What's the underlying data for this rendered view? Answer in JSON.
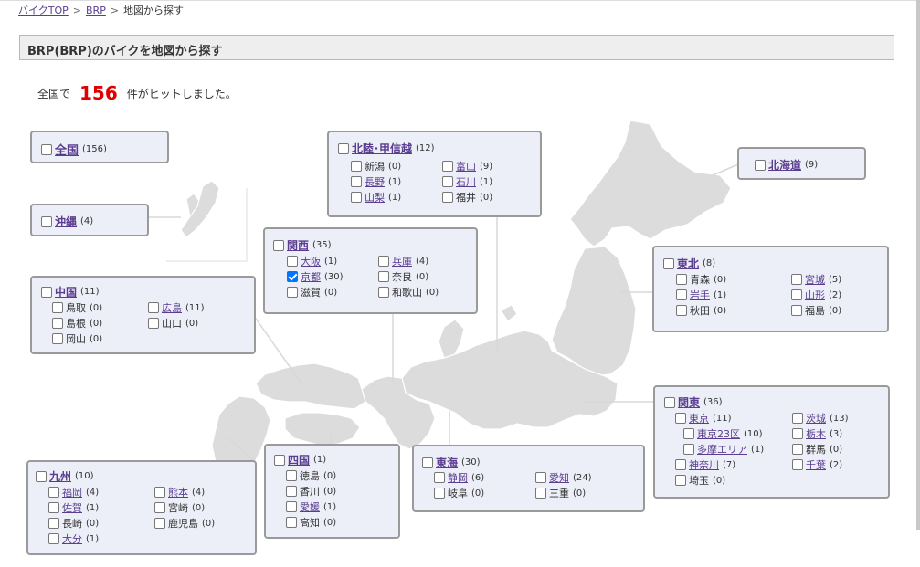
{
  "breadcrumb": {
    "home": "バイクTOP",
    "brand": "BRP",
    "current": "地図から探す",
    "sep": ">"
  },
  "page_title": "BRP(BRP)のバイクを地図から探す",
  "result": {
    "prefix": "全国で",
    "count": "156",
    "suffix": "件がヒットしました。"
  },
  "regions": {
    "all": {
      "name": "全国",
      "count": "(156)"
    },
    "okinawa": {
      "name": "沖縄",
      "count": "(4)"
    },
    "hokuriku": {
      "name": "北陸･甲信越",
      "count": "(12)",
      "items": [
        {
          "name": "新潟",
          "count": "(0)",
          "link": false
        },
        {
          "name": "富山",
          "count": "(9)",
          "link": true
        },
        {
          "name": "長野",
          "count": "(1)",
          "link": true
        },
        {
          "name": "石川",
          "count": "(1)",
          "link": true
        },
        {
          "name": "山梨",
          "count": "(1)",
          "link": true
        },
        {
          "name": "福井",
          "count": "(0)",
          "link": false
        }
      ]
    },
    "hokkaido": {
      "name": "北海道",
      "count": "(9)"
    },
    "kansai": {
      "name": "関西",
      "count": "(35)",
      "items": [
        {
          "name": "大阪",
          "count": "(1)",
          "link": true
        },
        {
          "name": "兵庫",
          "count": "(4)",
          "link": true
        },
        {
          "name": "京都",
          "count": "(30)",
          "link": true,
          "checked": true
        },
        {
          "name": "奈良",
          "count": "(0)",
          "link": false
        },
        {
          "name": "滋賀",
          "count": "(0)",
          "link": false
        },
        {
          "name": "和歌山",
          "count": "(0)",
          "link": false
        }
      ]
    },
    "chugoku": {
      "name": "中国",
      "count": "(11)",
      "items": [
        {
          "name": "鳥取",
          "count": "(0)",
          "link": false
        },
        {
          "name": "広島",
          "count": "(11)",
          "link": true
        },
        {
          "name": "島根",
          "count": "(0)",
          "link": false
        },
        {
          "name": "山口",
          "count": "(0)",
          "link": false
        },
        {
          "name": "岡山",
          "count": "(0)",
          "link": false
        }
      ]
    },
    "tohoku": {
      "name": "東北",
      "count": "(8)",
      "items": [
        {
          "name": "青森",
          "count": "(0)",
          "link": false
        },
        {
          "name": "宮城",
          "count": "(5)",
          "link": true
        },
        {
          "name": "岩手",
          "count": "(1)",
          "link": true
        },
        {
          "name": "山形",
          "count": "(2)",
          "link": true
        },
        {
          "name": "秋田",
          "count": "(0)",
          "link": false
        },
        {
          "name": "福島",
          "count": "(0)",
          "link": false
        }
      ]
    },
    "kanto": {
      "name": "関東",
      "count": "(36)",
      "items": [
        {
          "name": "東京",
          "count": "(11)",
          "link": true
        },
        {
          "name": "茨城",
          "count": "(13)",
          "link": true
        },
        {
          "name": "東京23区",
          "count": "(10)",
          "link": true
        },
        {
          "name": "栃木",
          "count": "(3)",
          "link": true
        },
        {
          "name": "多摩エリア",
          "count": "(1)",
          "link": true
        },
        {
          "name": "群馬",
          "count": "(0)",
          "link": false
        },
        {
          "name": "神奈川",
          "count": "(7)",
          "link": true
        },
        {
          "name": "千葉",
          "count": "(2)",
          "link": true
        },
        {
          "name": "埼玉",
          "count": "(0)",
          "link": false
        }
      ]
    },
    "kyushu": {
      "name": "九州",
      "count": "(10)",
      "items": [
        {
          "name": "福岡",
          "count": "(4)",
          "link": true
        },
        {
          "name": "熊本",
          "count": "(4)",
          "link": true
        },
        {
          "name": "佐賀",
          "count": "(1)",
          "link": true
        },
        {
          "name": "宮崎",
          "count": "(0)",
          "link": false
        },
        {
          "name": "長崎",
          "count": "(0)",
          "link": false
        },
        {
          "name": "鹿児島",
          "count": "(0)",
          "link": false
        },
        {
          "name": "大分",
          "count": "(1)",
          "link": true
        }
      ]
    },
    "shikoku": {
      "name": "四国",
      "count": "(1)",
      "items": [
        {
          "name": "徳島",
          "count": "(0)",
          "link": false
        },
        {
          "name": "香川",
          "count": "(0)",
          "link": false
        },
        {
          "name": "愛媛",
          "count": "(1)",
          "link": true
        },
        {
          "name": "高知",
          "count": "(0)",
          "link": false
        }
      ]
    },
    "tokai": {
      "name": "東海",
      "count": "(30)",
      "items": [
        {
          "name": "静岡",
          "count": "(6)",
          "link": true
        },
        {
          "name": "愛知",
          "count": "(24)",
          "link": true
        },
        {
          "name": "岐阜",
          "count": "(0)",
          "link": false
        },
        {
          "name": "三重",
          "count": "(0)",
          "link": false
        }
      ]
    }
  },
  "colors": {
    "link": "#5a3d8f",
    "count_red": "#e00000",
    "box_bg": "#eceef8",
    "map": "#d9d9d9"
  }
}
